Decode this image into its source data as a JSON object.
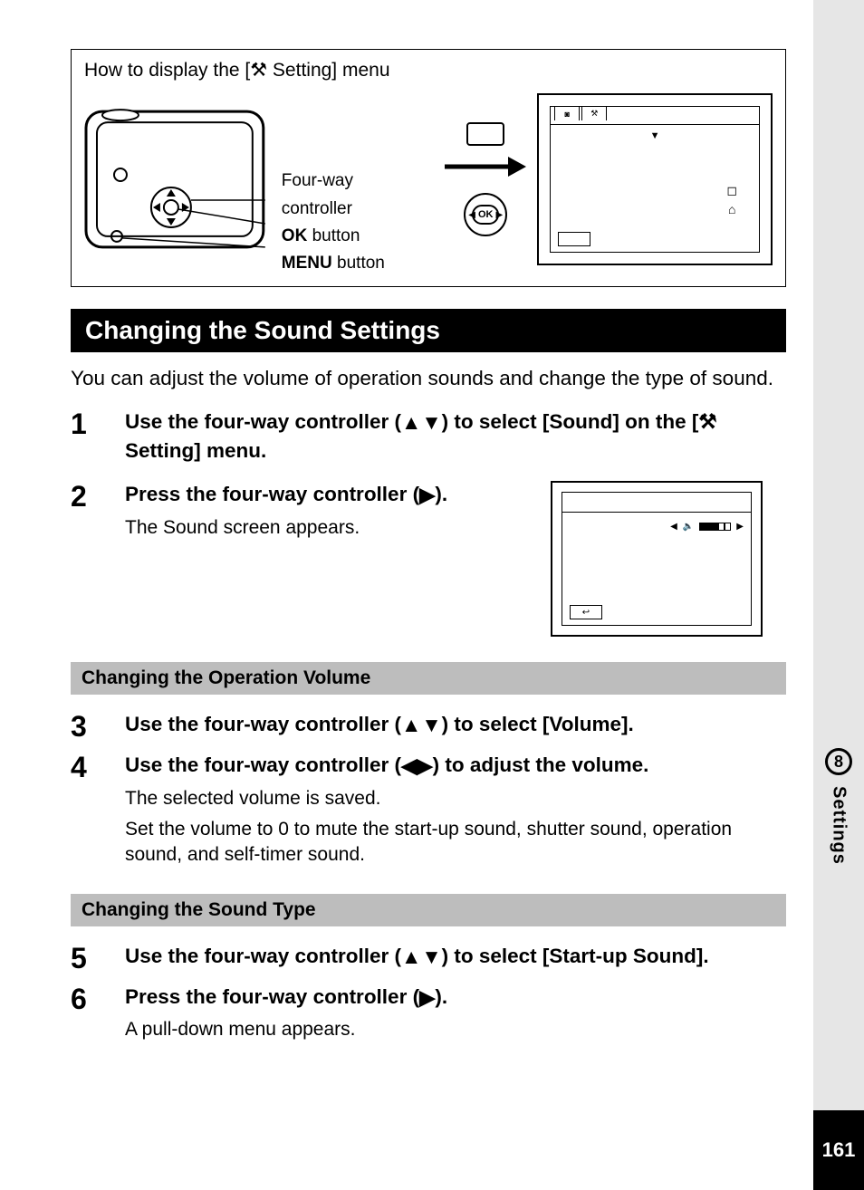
{
  "howto": {
    "title_pre": "How to display the [",
    "title_icon": "tools-icon",
    "title_post": " Setting] menu",
    "label_fourway": "Four-way controller",
    "label_ok_bold": "OK",
    "label_ok_rest": " button",
    "label_menu_bold": "MENU",
    "label_menu_rest": " button",
    "ok_text": "OK"
  },
  "section_title": "Changing the Sound Settings",
  "intro": "You can adjust the volume of operation sounds and change the type of sound.",
  "steps": {
    "s1": {
      "num": "1",
      "main_pre": "Use the four-way controller (",
      "main_post": ") to select [Sound] on the [",
      "main_end": " Setting] menu."
    },
    "s2": {
      "num": "2",
      "main_pre": "Press the four-way controller (",
      "main_post": ").",
      "sub": "The Sound screen appears."
    },
    "s3": {
      "num": "3",
      "main_pre": "Use the four-way controller (",
      "main_post": ") to select [Volume]."
    },
    "s4": {
      "num": "4",
      "main_pre": "Use the four-way controller (",
      "main_post": ") to adjust the volume.",
      "sub1": "The selected volume is saved.",
      "sub2": "Set the volume to 0 to mute the start-up sound, shutter sound, operation sound, and self-timer sound."
    },
    "s5": {
      "num": "5",
      "main_pre": "Use the four-way controller (",
      "main_post": ") to select [Start-up Sound]."
    },
    "s6": {
      "num": "6",
      "main_pre": "Press the four-way controller (",
      "main_post": ").",
      "sub": "A pull-down menu appears."
    }
  },
  "subbar1": "Changing the Operation Volume",
  "subbar2": "Changing the Sound Type",
  "side": {
    "chapter": "8",
    "label": "Settings"
  },
  "page_number": "161",
  "glyphs": {
    "up": "▲",
    "down": "▼",
    "left": "◀",
    "right": "▶",
    "tools": "⚒",
    "speaker": "🔈",
    "back": "↩",
    "camera": "◙",
    "square": "◻",
    "home": "⌂"
  }
}
